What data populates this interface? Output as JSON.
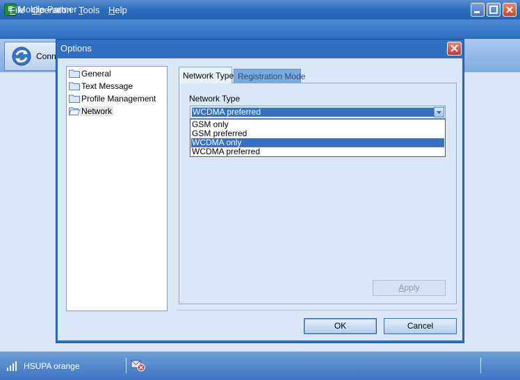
{
  "window": {
    "title": "Mobile Partner",
    "icon": "mobile-partner-icon",
    "controls": [
      "minimize-icon",
      "maximize-icon",
      "close-icon"
    ]
  },
  "menu": [
    {
      "label": "File",
      "mnemonic": "F",
      "rest": "ile"
    },
    {
      "label": "Operation",
      "mnemonic": "O",
      "rest": "peration"
    },
    {
      "label": "Tools",
      "mnemonic": "T",
      "rest": "ools"
    },
    {
      "label": "Help",
      "mnemonic": "H",
      "rest": "elp"
    }
  ],
  "toolbar": {
    "connect_label": "Conne"
  },
  "dialog": {
    "title": "Options",
    "tree": [
      {
        "label": "General",
        "selected": false
      },
      {
        "label": "Text Message",
        "selected": false
      },
      {
        "label": "Profile Management",
        "selected": false
      },
      {
        "label": "Network",
        "selected": true
      }
    ],
    "tabs": [
      {
        "label": "Network Type",
        "active": true
      },
      {
        "label": "Registration Mode",
        "active": false
      }
    ],
    "network_type": {
      "label": "Network Type",
      "selected_value": "WCDMA preferred",
      "options": [
        "GSM only",
        "GSM preferred",
        "WCDMA only",
        "WCDMA preferred"
      ],
      "highlighted_option": "WCDMA only"
    },
    "buttons": {
      "apply": {
        "mnemonic": "A",
        "rest": "pply",
        "label": "Apply",
        "enabled": false
      },
      "ok": "OK",
      "cancel": "Cancel"
    }
  },
  "statusbar": {
    "network_text": "HSUPA orange",
    "signal_icon": "signal-strength-icon",
    "sms_icon": "sms-error-icon"
  },
  "colors": {
    "titlebar": "#2f6fbf",
    "selection": "#3670c7",
    "dialog_body": "#d9e7f7",
    "close_button": "#c8412a"
  }
}
